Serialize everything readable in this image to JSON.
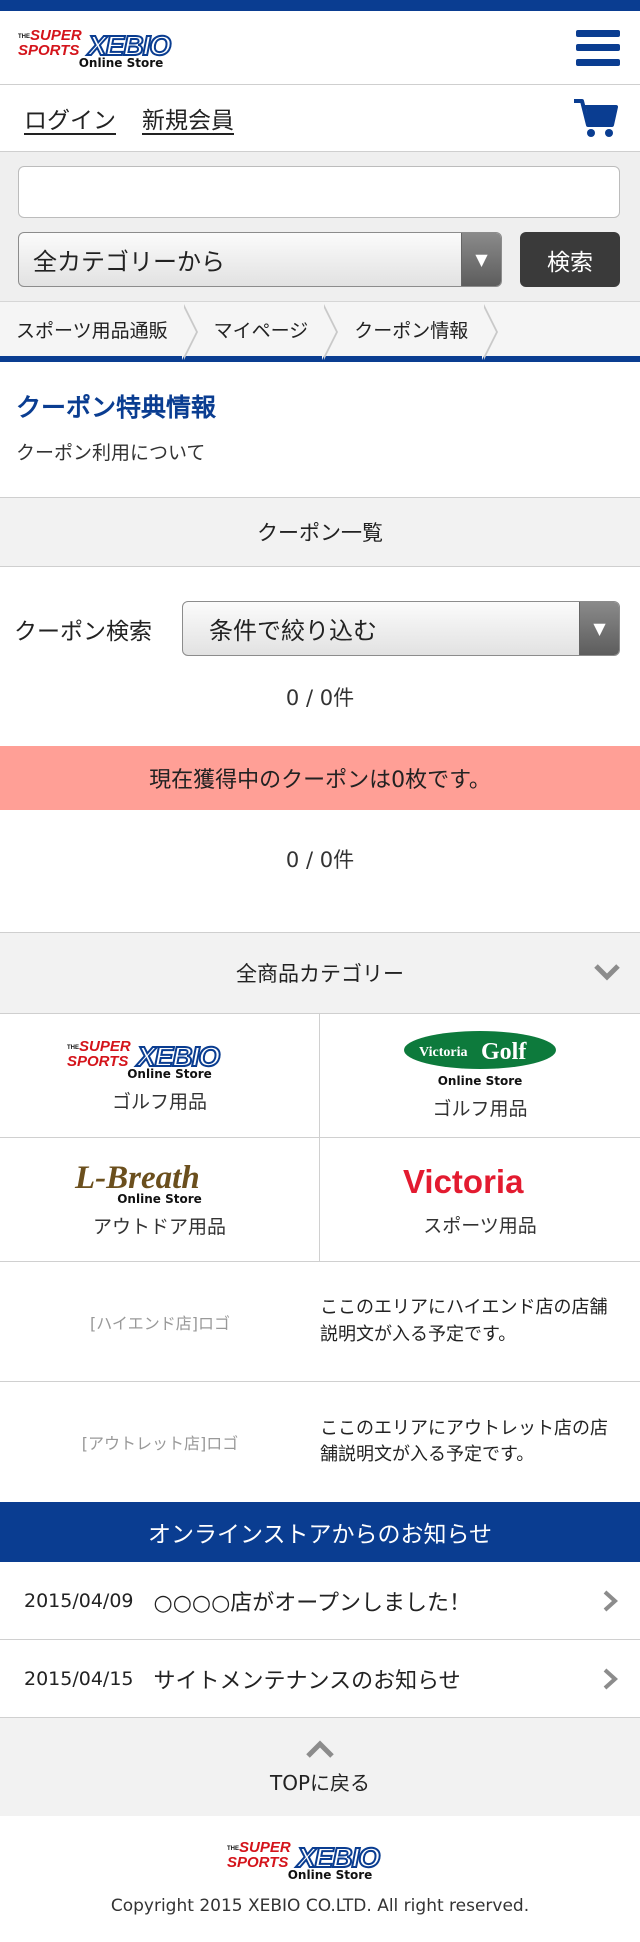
{
  "brand": {
    "logo_text": "SUPER SPORTS XEBIO",
    "logo_sub": "Online Store",
    "primary_color": "#0a3d91"
  },
  "account": {
    "login": "ログイン",
    "register": "新規会員"
  },
  "search": {
    "input_value": "",
    "category_select": "全カテゴリーから",
    "button": "検索"
  },
  "breadcrumb": [
    "スポーツ用品通販",
    "マイページ",
    "クーポン情報"
  ],
  "page": {
    "title": "クーポン特典情報",
    "subtitle": "クーポン利用について"
  },
  "coupon_list": {
    "header": "クーポン一覧",
    "search_label": "クーポン検索",
    "filter_select": "条件で絞り込む",
    "count_top": "0 / 0件",
    "notice": "現在獲得中のクーポンは0枚です。",
    "count_bottom": "0 / 0件",
    "notice_color": "#ff9f96"
  },
  "categories": {
    "header": "全商品カテゴリー",
    "stores": [
      {
        "logo": "SUPER SPORTS XEBIO",
        "logo_sub": "Online Store",
        "label": "ゴルフ用品"
      },
      {
        "logo": "Victoria Golf",
        "logo_sub": "Online Store",
        "label": "ゴルフ用品"
      },
      {
        "logo": "L-Breath",
        "logo_sub": "Online Store",
        "label": "アウトドア用品"
      },
      {
        "logo": "Victoria",
        "logo_sub": "",
        "label": "スポーツ用品"
      }
    ],
    "promos": [
      {
        "logo_placeholder": "[ハイエンド店]ロゴ",
        "desc": "ここのエリアにハイエンド店の店舗説明文が入る予定です。"
      },
      {
        "logo_placeholder": "[アウトレット店]ロゴ",
        "desc": "ここのエリアにアウトレット店の店舗説明文が入る予定です。"
      }
    ]
  },
  "news": {
    "header": "オンラインストアからのお知らせ",
    "items": [
      {
        "date": "2015/04/09",
        "title": "○○○○店がオープンしました！"
      },
      {
        "date": "2015/04/15",
        "title": "サイトメンテナンスのお知らせ"
      }
    ]
  },
  "footer": {
    "to_top": "TOPに戻る",
    "copyright": "Copyright 2015 XEBIO CO.LTD. All right reserved."
  }
}
